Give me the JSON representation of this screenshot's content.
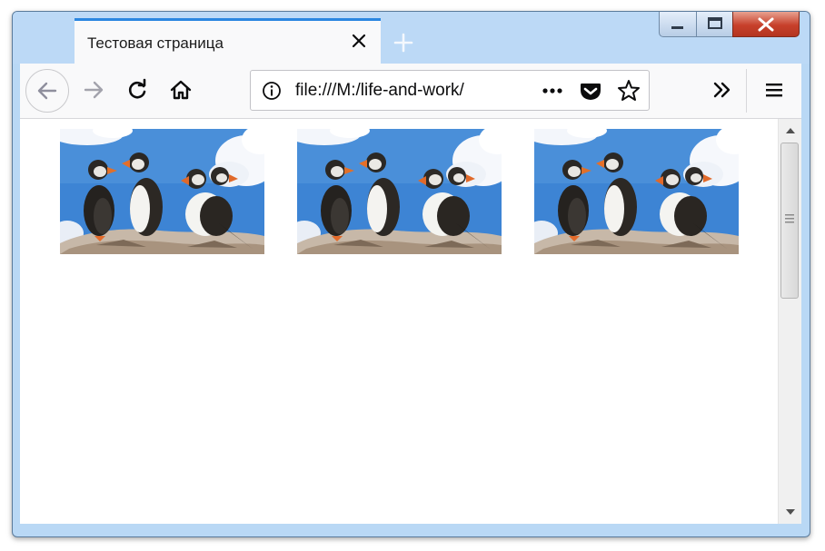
{
  "tab": {
    "title": "Тестовая страница"
  },
  "urlbar": {
    "url": "file:///M:/life-and-work/"
  },
  "icons": {
    "tab_close": "close-icon",
    "new_tab": "plus-icon",
    "back": "arrow-left-icon",
    "forward": "arrow-right-icon",
    "reload": "reload-icon",
    "home": "home-icon",
    "site_info": "info-icon",
    "page_actions": "more-horizontal-icon",
    "pocket": "pocket-icon",
    "bookmark": "star-icon",
    "overflow": "double-chevron-right-icon",
    "menu": "hamburger-menu-icon",
    "minimize": "minimize-icon",
    "maximize": "maximize-icon",
    "close_window": "close-icon"
  },
  "page": {
    "images": [
      {
        "subject": "puffins"
      },
      {
        "subject": "puffins"
      },
      {
        "subject": "puffins"
      }
    ]
  },
  "colors": {
    "tab_accent": "#2a86e0",
    "titlebar": "#bcd9f6",
    "close_button": "#c7402b",
    "sky": "#3f86d6"
  }
}
